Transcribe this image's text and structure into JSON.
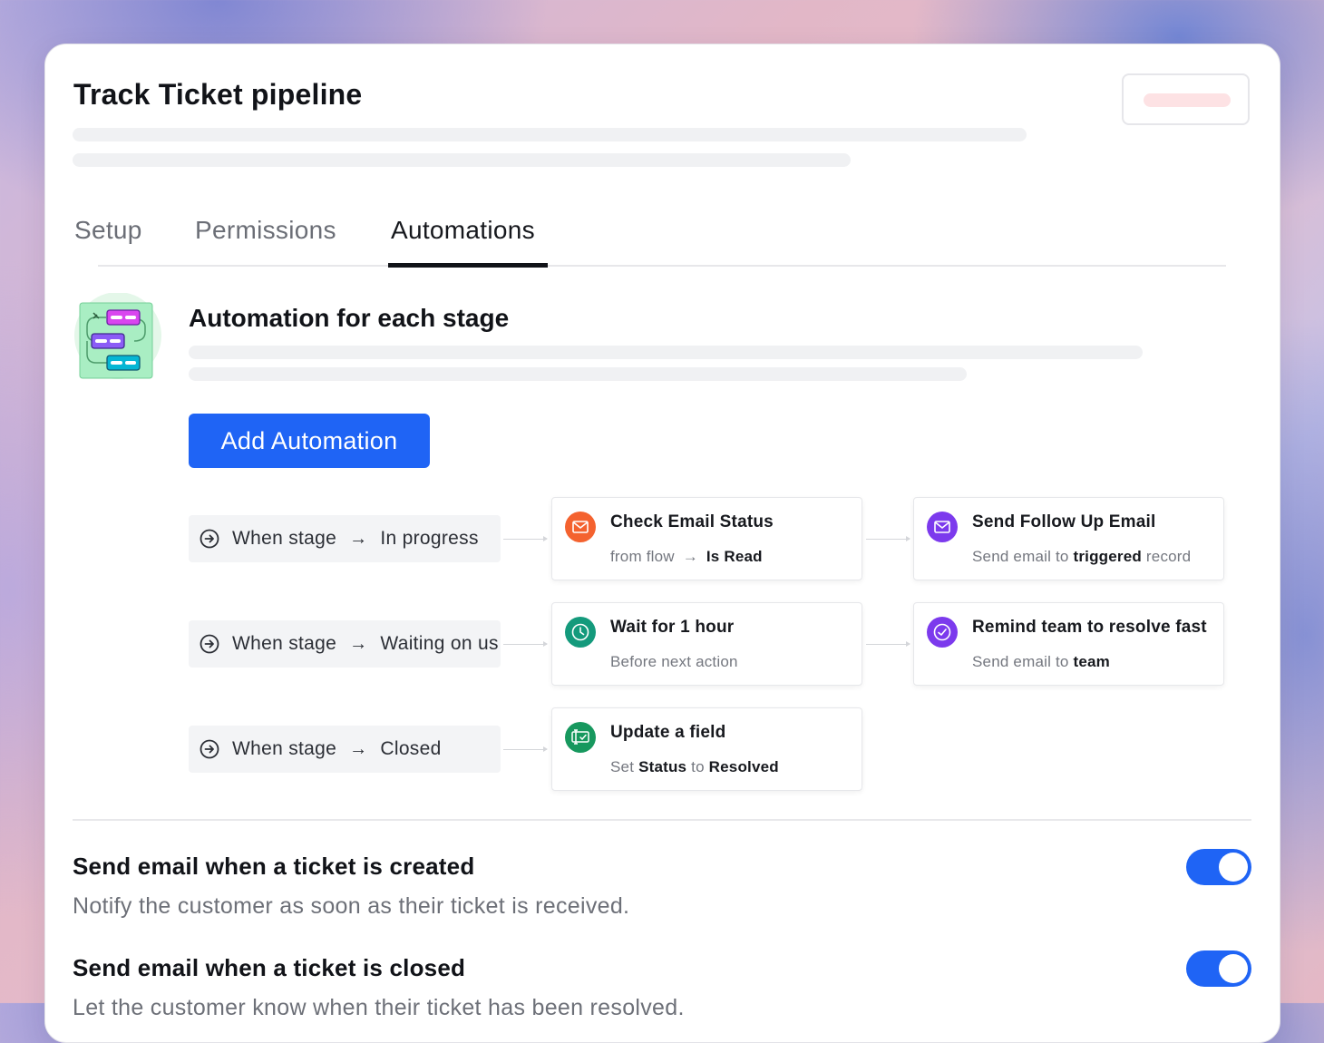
{
  "page": {
    "title": "Track Ticket pipeline"
  },
  "tabs": [
    {
      "label": "Setup",
      "active": false
    },
    {
      "label": "Permissions",
      "active": false
    },
    {
      "label": "Automations",
      "active": true
    }
  ],
  "automation_section": {
    "title": "Automation for each stage",
    "add_button_label": "Add Automation"
  },
  "triggers": [
    {
      "prefix": "When stage",
      "stage": "In progress"
    },
    {
      "prefix": "When stage",
      "stage": "Waiting on us"
    },
    {
      "prefix": "When stage",
      "stage": "Closed"
    }
  ],
  "actions": {
    "check_email": {
      "title": "Check Email Status",
      "sub_pre": "from flow",
      "sub_bold": "Is Read",
      "color": "#f4622f",
      "icon": "mail-icon"
    },
    "wait": {
      "title": "Wait for 1 hour",
      "sub": "Before next action",
      "color": "#149a7c",
      "icon": "clock-icon"
    },
    "update_field": {
      "title": "Update a field",
      "sub_pre": "Set",
      "sub_bold1": "Status",
      "sub_mid": "to",
      "sub_bold2": "Resolved",
      "color": "#17985e",
      "icon": "update-field-icon"
    },
    "follow_up": {
      "title": "Send Follow Up Email",
      "sub_pre": "Send email to",
      "sub_bold": "triggered",
      "sub_post": "record",
      "color": "#7c3aed",
      "icon": "mail-icon"
    },
    "remind_team": {
      "title": "Remind team to resolve fast",
      "sub_pre": "Send email to",
      "sub_bold": "team",
      "color": "#7c3aed",
      "icon": "check-circle-icon"
    }
  },
  "settings": [
    {
      "title": "Send email when a ticket is created",
      "desc": "Notify the customer as soon as their ticket is received.",
      "enabled": true
    },
    {
      "title": "Send email when a ticket is closed",
      "desc": "Let the customer know when their ticket has been resolved.",
      "enabled": true
    }
  ],
  "colors": {
    "primary": "#1f64f5",
    "text": "#111318",
    "muted": "#6d7078"
  }
}
